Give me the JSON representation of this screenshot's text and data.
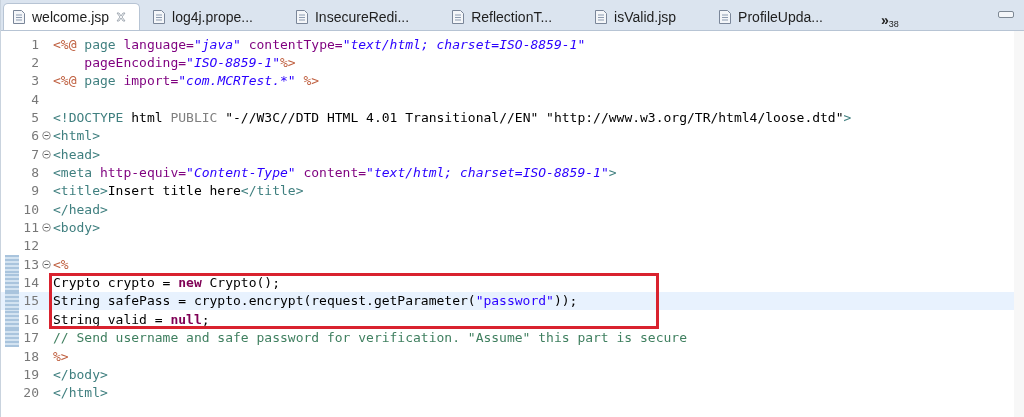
{
  "tabs": [
    {
      "label": "welcome.jsp",
      "selected": true,
      "closable": true
    },
    {
      "label": "log4j.prope...",
      "selected": false,
      "closable": false
    },
    {
      "label": "InsecureRedi...",
      "selected": false,
      "closable": false
    },
    {
      "label": "ReflectionT...",
      "selected": false,
      "closable": false
    },
    {
      "label": "isValid.jsp",
      "selected": false,
      "closable": false
    },
    {
      "label": "ProfileUpda...",
      "selected": false,
      "closable": false
    }
  ],
  "overflow": {
    "symbol": "»",
    "count": "38"
  },
  "lines": [
    {
      "number": "1",
      "foldable": false,
      "changed": false,
      "current": false,
      "boxed": false,
      "tokens": [
        {
          "kind": "directive",
          "text": "<%@"
        },
        {
          "kind": "tag",
          "text": " page"
        },
        {
          "kind": "attr",
          "text": " language="
        },
        {
          "kind": "string",
          "text": "\"java\""
        },
        {
          "kind": "attr",
          "text": " contentType="
        },
        {
          "kind": "string",
          "text": "\"text/html; charset=ISO-8859-1\""
        }
      ]
    },
    {
      "number": "2",
      "foldable": false,
      "changed": false,
      "current": false,
      "boxed": false,
      "tokens": [
        {
          "kind": "attr",
          "text": "    pageEncoding="
        },
        {
          "kind": "string",
          "text": "\"ISO-8859-1\""
        },
        {
          "kind": "directive",
          "text": "%>"
        }
      ]
    },
    {
      "number": "3",
      "foldable": false,
      "changed": false,
      "current": false,
      "boxed": false,
      "tokens": [
        {
          "kind": "directive",
          "text": "<%@"
        },
        {
          "kind": "tag",
          "text": " page"
        },
        {
          "kind": "attr",
          "text": " import="
        },
        {
          "kind": "string",
          "text": "\"com.MCRTest.*\""
        },
        {
          "kind": "directive",
          "text": " %>"
        }
      ]
    },
    {
      "number": "4",
      "foldable": false,
      "changed": false,
      "current": false,
      "boxed": false
    },
    {
      "number": "5",
      "foldable": false,
      "changed": false,
      "current": false,
      "boxed": false,
      "tokens": [
        {
          "kind": "tag",
          "text": "<!DOCTYPE"
        },
        {
          "kind": "plain",
          "text": " html "
        },
        {
          "kind": "doctype",
          "text": "PUBLIC"
        },
        {
          "kind": "plain",
          "text": " \"-//W3C//DTD HTML 4.01 Transitional//EN\" \"http://www.w3.org/TR/html4/loose.dtd\""
        },
        {
          "kind": "tag",
          "text": ">"
        }
      ]
    },
    {
      "number": "6",
      "foldable": true,
      "changed": false,
      "current": false,
      "boxed": false,
      "tokens": [
        {
          "kind": "tag",
          "text": "<html>"
        }
      ]
    },
    {
      "number": "7",
      "foldable": true,
      "changed": false,
      "current": false,
      "boxed": false,
      "tokens": [
        {
          "kind": "tag",
          "text": "<head>"
        }
      ]
    },
    {
      "number": "8",
      "foldable": false,
      "changed": false,
      "current": false,
      "boxed": false,
      "tokens": [
        {
          "kind": "tag",
          "text": "<meta"
        },
        {
          "kind": "attr",
          "text": " http-equiv="
        },
        {
          "kind": "string",
          "text": "\"Content-Type\""
        },
        {
          "kind": "attr",
          "text": " content="
        },
        {
          "kind": "string",
          "text": "\"text/html; charset=ISO-8859-1\""
        },
        {
          "kind": "tag",
          "text": ">"
        }
      ]
    },
    {
      "number": "9",
      "foldable": false,
      "changed": false,
      "current": false,
      "boxed": false,
      "tokens": [
        {
          "kind": "tag",
          "text": "<title>"
        },
        {
          "kind": "plain",
          "text": "Insert title here"
        },
        {
          "kind": "tag",
          "text": "</title>"
        }
      ]
    },
    {
      "number": "10",
      "foldable": false,
      "changed": false,
      "current": false,
      "boxed": false,
      "tokens": [
        {
          "kind": "tag",
          "text": "</head>"
        }
      ]
    },
    {
      "number": "11",
      "foldable": true,
      "changed": false,
      "current": false,
      "boxed": false,
      "tokens": [
        {
          "kind": "tag",
          "text": "<body>"
        }
      ]
    },
    {
      "number": "12",
      "foldable": false,
      "changed": false,
      "current": false,
      "boxed": false
    },
    {
      "number": "13",
      "foldable": true,
      "changed": true,
      "current": false,
      "boxed": false,
      "tokens": [
        {
          "kind": "directive",
          "text": "<%"
        }
      ]
    },
    {
      "number": "14",
      "foldable": false,
      "changed": true,
      "current": false,
      "boxed": true,
      "tokens": [
        {
          "kind": "plain",
          "text": "Crypto crypto = "
        },
        {
          "kind": "keyword",
          "text": "new"
        },
        {
          "kind": "plain",
          "text": " Crypto();"
        }
      ]
    },
    {
      "number": "15",
      "foldable": false,
      "changed": true,
      "current": true,
      "boxed": true,
      "tokens": [
        {
          "kind": "plain",
          "text": "String safePass = crypto.encrypt(request.getParameter("
        },
        {
          "kind": "java-string",
          "text": "\"password\""
        },
        {
          "kind": "plain",
          "text": "));"
        }
      ]
    },
    {
      "number": "16",
      "foldable": false,
      "changed": true,
      "current": false,
      "boxed": true,
      "tokens": [
        {
          "kind": "plain",
          "text": "String valid = "
        },
        {
          "kind": "keyword",
          "text": "null"
        },
        {
          "kind": "plain",
          "text": ";"
        }
      ]
    },
    {
      "number": "17",
      "foldable": false,
      "changed": true,
      "current": false,
      "boxed": false,
      "tokens": [
        {
          "kind": "comment",
          "text": "// Send username and safe password for verification. \"Assume\" this part is secure"
        }
      ]
    },
    {
      "number": "18",
      "foldable": false,
      "changed": false,
      "current": false,
      "boxed": false,
      "tokens": [
        {
          "kind": "directive",
          "text": "%>"
        }
      ]
    },
    {
      "number": "19",
      "foldable": false,
      "changed": false,
      "current": false,
      "boxed": false,
      "tokens": [
        {
          "kind": "tag",
          "text": "</body>"
        }
      ]
    },
    {
      "number": "20",
      "foldable": false,
      "changed": false,
      "current": false,
      "boxed": false,
      "tokens": [
        {
          "kind": "tag",
          "text": "</html>"
        }
      ]
    }
  ]
}
